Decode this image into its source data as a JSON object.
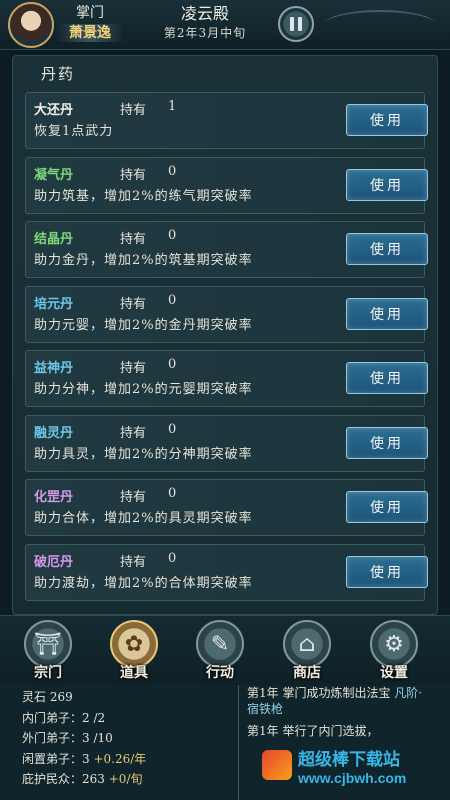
{
  "header": {
    "role_title": "掌门",
    "role_name": "萧景逸",
    "hall_name": "凌云殿",
    "date": "第2年3月中旬",
    "pause_icon": "pause-icon"
  },
  "panel": {
    "title": "丹药",
    "held_label": "持有",
    "use_label": "使用",
    "items": [
      {
        "name": "大还丹",
        "held": "1",
        "desc": "恢复1点武力",
        "color": "#f2f0e6"
      },
      {
        "name": "凝气丹",
        "held": "0",
        "desc": "助力筑基，增加2%的练气期突破率",
        "color": "#7ed67a"
      },
      {
        "name": "结晶丹",
        "held": "0",
        "desc": "助力金丹，增加2%的筑基期突破率",
        "color": "#7ed67a"
      },
      {
        "name": "培元丹",
        "held": "0",
        "desc": "助力元婴，增加2%的金丹期突破率",
        "color": "#6fc7e8"
      },
      {
        "name": "益神丹",
        "held": "0",
        "desc": "助力分神，增加2%的元婴期突破率",
        "color": "#6fc7e8"
      },
      {
        "name": "融灵丹",
        "held": "0",
        "desc": "助力具灵，增加2%的分神期突破率",
        "color": "#6fc7e8"
      },
      {
        "name": "化罡丹",
        "held": "0",
        "desc": "助力合体，增加2%的具灵期突破率",
        "color": "#d49ae8"
      },
      {
        "name": "破厄丹",
        "held": "0",
        "desc": "助力渡劫，增加2%的合体期突破率",
        "color": "#d49ae8"
      }
    ]
  },
  "nav": {
    "items": [
      {
        "label": "宗门",
        "icon": "sect-icon",
        "glyph": "⛩"
      },
      {
        "label": "道具",
        "icon": "bag-icon",
        "glyph": "✿"
      },
      {
        "label": "行动",
        "icon": "action-icon",
        "glyph": "✎"
      },
      {
        "label": "商店",
        "icon": "shop-icon",
        "glyph": "⌂"
      },
      {
        "label": "设置",
        "icon": "settings-icon",
        "glyph": "⚙"
      }
    ],
    "active": 1
  },
  "stats": {
    "spirit_stone_label": "灵石",
    "spirit_stone": "269",
    "inner_label": "内门弟子：",
    "inner": "2",
    "inner_max": "2",
    "outer_label": "外门弟子：",
    "outer": "3",
    "outer_max": "10",
    "idle_label": "闲置弟子：",
    "idle": "3",
    "idle_rate": "+0.26/年",
    "protect_label": "庇护民众：",
    "protect": "263",
    "protect_rate": "+0/旬"
  },
  "log": {
    "entry1_prefix": "第1年 掌门成功炼制出法宝",
    "entry1_item": "凡阶·宿铁枪",
    "entry2": "第1年 举行了内门选拔，"
  },
  "watermark": {
    "title": "超级棒下载站",
    "url": "www.cjbwh.com"
  }
}
